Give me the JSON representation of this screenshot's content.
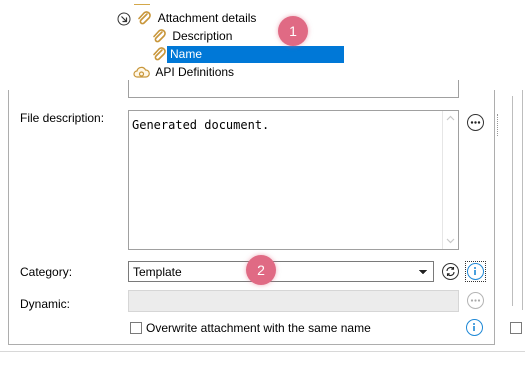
{
  "tree": {
    "attachment_details": "Attachment details",
    "description": "Description",
    "name": "Name",
    "api_definitions": "API Definitions"
  },
  "form": {
    "file_description_label": "File description:",
    "file_description_value": "Generated document.",
    "category_label": "Category:",
    "category_value": "Template",
    "dynamic_label": "Dynamic:",
    "dynamic_value": "",
    "overwrite_label": "Overwrite attachment with the same name",
    "overwrite_checked": false
  },
  "badges": {
    "badge1": "1",
    "badge2": "2"
  },
  "colors": {
    "selection": "#0078d7",
    "badge": "#e06a84",
    "info": "#1e88d6",
    "clip": "#d4a84a"
  }
}
